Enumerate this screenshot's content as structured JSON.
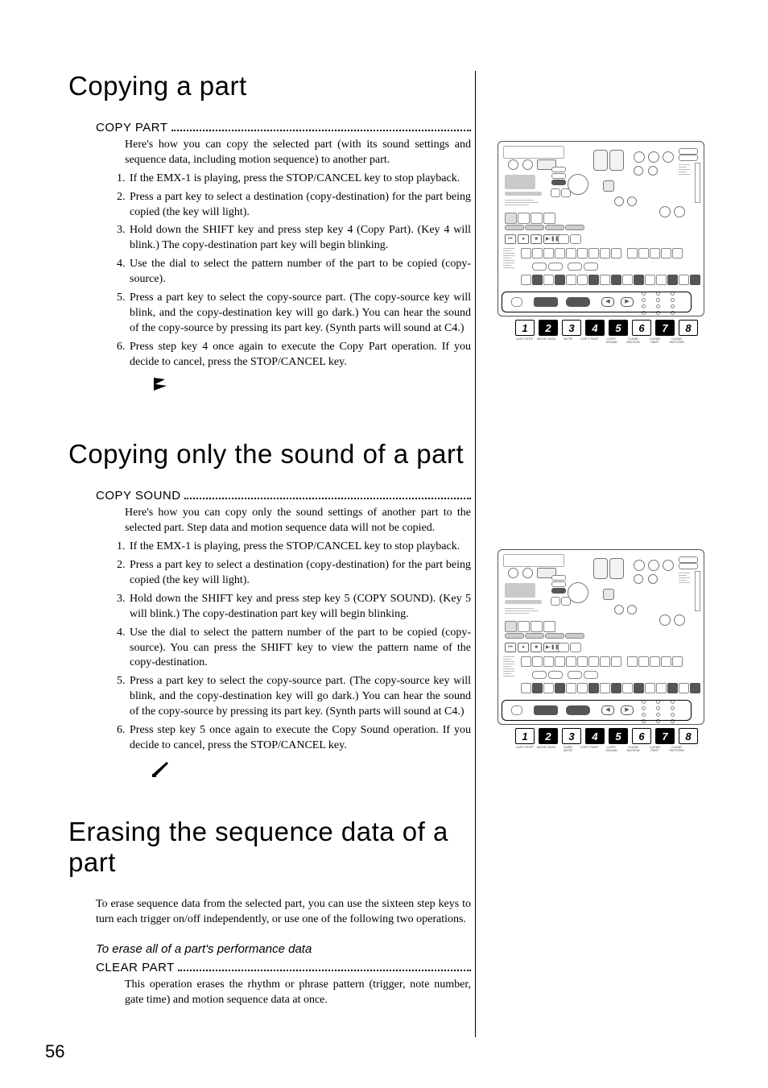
{
  "page_number": "56",
  "section1": {
    "title": "Copying a part",
    "subhead": "COPY PART",
    "intro": "Here's how you can copy the selected part (with its sound settings and sequence data, including motion sequence) to another part.",
    "steps": [
      "If the EMX-1 is playing, press the STOP/CANCEL key to stop playback.",
      "Press a part key to select a destination (copy-destination) for the part being copied (the key will light).",
      "Hold down the SHIFT key and press step key 4 (Copy Part). (Key 4 will blink.) The copy-destination part key will begin blinking.",
      "Use the dial to select the pattern number of the part to be copied (copy-source).",
      "Press a part key to select the copy-source part. (The copy-source key will blink, and the copy-destination key will go dark.) You can hear the sound of the copy-source by pressing its part key. (Synth parts will sound at C4.)",
      "Press step key 4 once again to execute the Copy Part operation. If you decide to cancel, press the STOP/CANCEL key."
    ]
  },
  "section2": {
    "title": "Copying only the sound of a part",
    "subhead": "COPY SOUND",
    "intro": "Here's how you can copy only the sound settings of another part to the selected part. Step data and motion sequence data will not be copied.",
    "steps": [
      "If the EMX-1 is playing, press the STOP/CANCEL key to stop playback.",
      "Press a part key to select a destination (copy-destination) for the part being copied (the key will light).",
      "Hold down the SHIFT key and press step key 5 (COPY SOUND). (Key 5 will blink.) The copy-destination part key will begin blinking.",
      "Use the dial to select the pattern number of the part to be copied (copy-source). You can press the SHIFT key to view the pattern name of the copy-destination.",
      "Press a part key to select the copy-source part. (The copy-source key will blink, and the copy-destination key will go dark.) You can hear the sound of the copy-source by pressing its part key. (Synth parts will sound at C4.)",
      "Press step key 5 once again to execute the Copy Sound operation. If you decide to cancel, press the STOP/CANCEL key."
    ]
  },
  "section3": {
    "title": "Erasing the sequence data of a part",
    "intro": "To erase sequence data from the selected part, you can use the sixteen step keys to turn each trigger on/off independently, or use one of the following two operations.",
    "italic_subhead": "To erase all of a part's performance data",
    "subhead": "CLEAR PART",
    "body": "This operation erases the rhythm or phrase pattern (trigger, note number, gate time) and motion sequence data at once."
  },
  "figure": {
    "stepnums": [
      "1",
      "2",
      "3",
      "4",
      "5",
      "6",
      "7",
      "8"
    ],
    "sublabels_a": [
      "LAST STEP",
      "MOVE DATA",
      "NOTE",
      "COPY PART",
      "COPY SOUND",
      "CLEAR MOTION",
      "CLEAR PART",
      "CLEAR PATTERN"
    ],
    "sublabels_b": [
      "LAST STEP",
      "MOVE DATA",
      "SURE NOTE",
      "COPY PART",
      "COPY SOUND",
      "CLEAR MOTION",
      "CLEAR PART",
      "CLEAR PATTERN"
    ],
    "fig1_dark": [
      1,
      3,
      4,
      6
    ],
    "fig2_dark": [
      1,
      3,
      4,
      6
    ]
  }
}
